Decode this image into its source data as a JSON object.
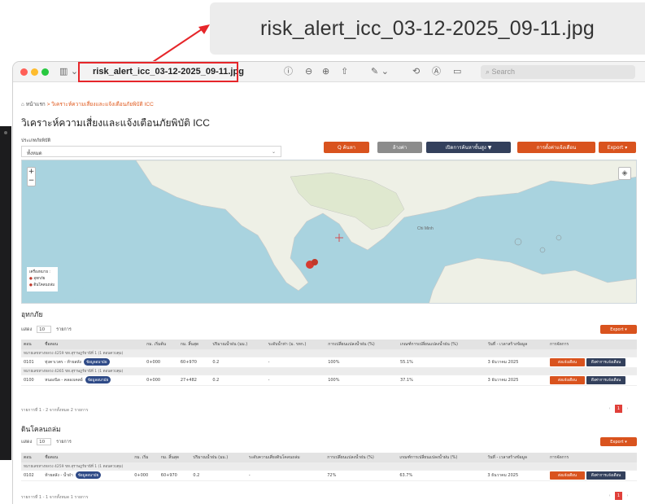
{
  "callout": {
    "filename": "risk_alert_icc_03-12-2025_09-11.jpg"
  },
  "window": {
    "title": "risk_alert_icc_03-12-2025_09-11.jpg",
    "search_placeholder": "Search",
    "toolbar_icons": [
      "sidebar-icon",
      "info-icon",
      "zoom-out-icon",
      "zoom-in-icon",
      "share-icon",
      "markup-icon",
      "rotate-icon",
      "annotate-icon",
      "form-icon"
    ]
  },
  "breadcrumb": {
    "home": "หน้าแรก",
    "current": "วิเคราะห์ความเสี่ยงและแจ้งเตือนภัยพิบัติ ICC"
  },
  "page_title": "วิเคราะห์ความเสี่ยงและแจ้งเตือนภัยพิบัติ ICC",
  "filter": {
    "label": "ประเภทภัยพิบัติ",
    "selected": "ทั้งหมด"
  },
  "buttons": {
    "search": "Q ค้นหา",
    "reset": "ล้างค่า",
    "advanced": "เปิดการค้นหาขั้นสูง ▼",
    "notify": "การตั้งค่าแจ้งเตือน",
    "export": "Export ▾"
  },
  "map": {
    "zoom_in": "+",
    "zoom_out": "−",
    "legend_title": "เครื่องหมาย :",
    "legend_items": [
      "อุทกภัย",
      "ดินโคลนถล่ม"
    ],
    "label_small": "Chi Minh"
  },
  "flood": {
    "title": "อุทกภัย",
    "show_label": "แสดง",
    "show_value": "10",
    "show_unit": "รายการ",
    "export": "Export ▾",
    "columns": [
      "ตอน",
      "ชื่อตอน",
      "กม. เริ่มต้น",
      "กม. สิ้นสุด",
      "ปริมาณน้ำฝน (มม.)",
      "ระดับน้ำท่า (ม. รทก.)",
      "การเปลี่ยนแปลงน้ำฝน (%)",
      "เกณฑ์การเปลี่ยนแปลงน้ำฝน (%)",
      "วันที่ - เวลาสร้างข้อมูล",
      "การจัดการ"
    ],
    "groups": [
      {
        "name": "หมายเลขทางหลวง 4259 ขท.สุราษฎร์ธานีที่ 1 (1 ตอนควบคุม)",
        "rows": [
          {
            "code": "0101",
            "name": "ทุ่งคาเวตร - ท้ายสลัง",
            "tag": "ข้อมูลอนามัย",
            "km_start": "0+000",
            "km_end": "60+970",
            "rain": "0.2",
            "level": "-",
            "change": "100%",
            "threshold": "55.1%",
            "date": "3 ธันวาคม 2025",
            "act1": "ส่งแจ้งเตือน",
            "act2": "ดึงค่าการแจ้งเตือน"
          }
        ]
      },
      {
        "name": "หมายเลขทางหลวง 4265 ขท.สุราษฎร์ธานีที่ 1 (1 ตอนควบคุม)",
        "rows": [
          {
            "code": "0100",
            "name": "หนองนิล - คลองเคลย์",
            "tag": "ข้อมูลอนามัย",
            "km_start": "0+000",
            "km_end": "27+482",
            "rain": "0.2",
            "level": "-",
            "change": "100%",
            "threshold": "37.1%",
            "date": "3 ธันวาคม 2025",
            "act1": "ส่งแจ้งเตือน",
            "act2": "ดึงค่าการแจ้งเตือน"
          }
        ]
      }
    ],
    "footer": "รายการที่ 1 - 2 จากทั้งหมด 2 รายการ",
    "page": "1"
  },
  "landslide": {
    "title": "ดินโคลนถล่ม",
    "show_label": "แสดง",
    "show_value": "10",
    "show_unit": "รายการ",
    "export": "Export ▾",
    "columns": [
      "ตอน",
      "ชื่อตอน",
      "กม. เริ่ม",
      "กม. สิ้นสุด",
      "ปริมาณน้ำฝน (มม.)",
      "ระดับความเสี่ยงดินโคลนถล่ม",
      "การเปลี่ยนแปลงน้ำฝน (%)",
      "เกณฑ์การเปลี่ยนแปลงน้ำฝน (%)",
      "วันที่ - เวลาสร้างข้อมูล",
      "การจัดการ"
    ],
    "groups": [
      {
        "name": "หมายเลขทางหลวง 4259 ขท.สุราษฎร์ธานีที่ 1 (1 ตอนควบคุม)",
        "rows": [
          {
            "code": "0102",
            "name": "ท้ายสลัง - น้ำฝ่า",
            "tag": "ข้อมูลอนามัย",
            "km_start": "0+000",
            "km_end": "60+970",
            "rain": "0.2",
            "level": "-",
            "change": "72%",
            "threshold": "63.7%",
            "date": "3 ธันวาคม 2025",
            "act1": "ส่งแจ้งเตือน",
            "act2": "ดึงค่าการแจ้งเตือน"
          }
        ]
      }
    ],
    "footer": "รายการที่ 1 - 1 จากทั้งหมด 1 รายการ",
    "page": "1"
  }
}
